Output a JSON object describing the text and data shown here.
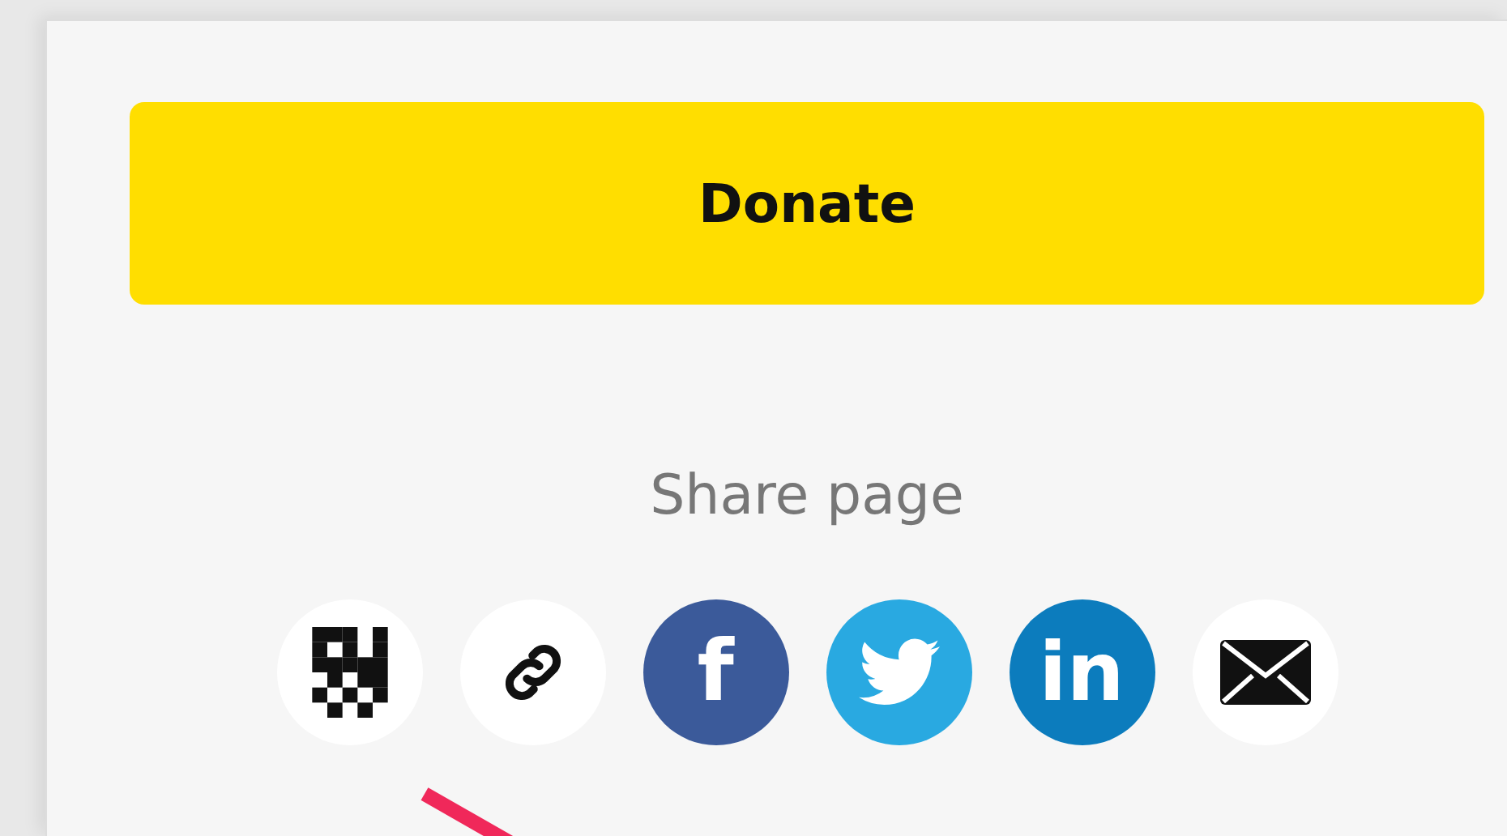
{
  "donate_button": {
    "label": "Donate"
  },
  "share": {
    "title": "Share page",
    "icons": [
      {
        "kind": "qr",
        "color": "#ffffff"
      },
      {
        "kind": "link",
        "color": "#ffffff"
      },
      {
        "kind": "facebook",
        "color": "#3b5a9a",
        "label": "f"
      },
      {
        "kind": "twitter",
        "color": "#29a9e1"
      },
      {
        "kind": "linkedin",
        "color": "#0c7cbd",
        "label": "in"
      },
      {
        "kind": "email",
        "color": "#ffffff"
      }
    ]
  }
}
